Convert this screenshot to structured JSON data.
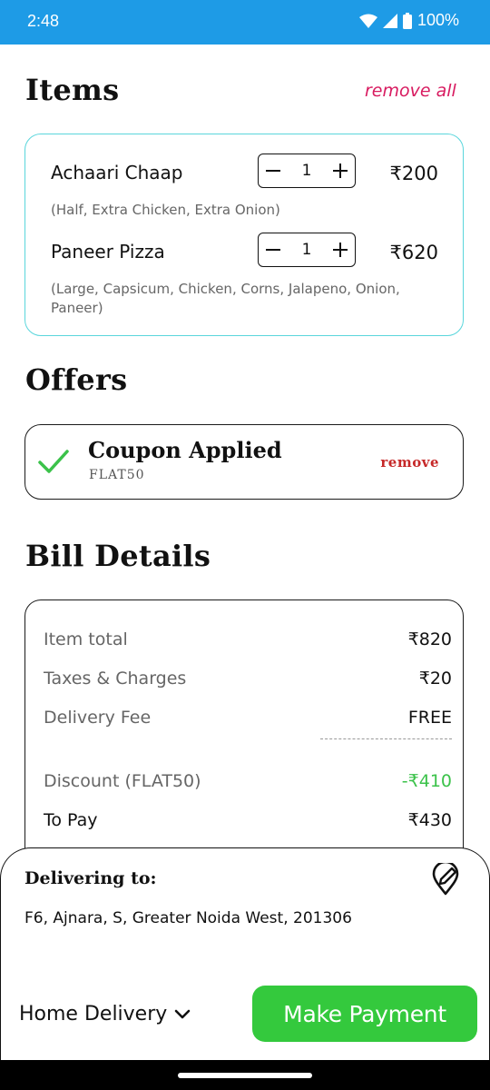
{
  "status_bar": {
    "time": "2:48",
    "battery": "100%"
  },
  "items_section": {
    "title": "Items",
    "remove_all_label": "remove all",
    "items": [
      {
        "name": "Achaari Chaap",
        "options": "(Half, Extra Chicken, Extra Onion)",
        "quantity": "1",
        "price": "₹200"
      },
      {
        "name": "Paneer Pizza",
        "options": "(Large, Capsicum, Chicken, Corns, Jalapeno, Onion, Paneer)",
        "quantity": "1",
        "price": "₹620"
      }
    ]
  },
  "offers_section": {
    "title": "Offers",
    "coupon_title": "Coupon Applied",
    "coupon_code": "FLAT50",
    "remove_label": "remove"
  },
  "bill_section": {
    "title": "Bill Details",
    "item_total_label": "Item total",
    "item_total_value": "₹820",
    "taxes_label": "Taxes & Charges",
    "taxes_value": "₹20",
    "delivery_label": "Delivery Fee",
    "delivery_value": "FREE",
    "discount_label": "Discount (FLAT50)",
    "discount_value": "-₹410",
    "to_pay_label": "To Pay",
    "to_pay_value": "₹430"
  },
  "delivery": {
    "title": "Delivering to:",
    "address": "F6, Ajnara, S, Greater Noida West, 201306",
    "mode": "Home Delivery",
    "pay_button": "Make Payment"
  },
  "colors": {
    "status_bar": "#1e9be6",
    "accent_green": "#34c93d",
    "remove_pink": "#d81b60",
    "remove_red": "#c62828"
  }
}
